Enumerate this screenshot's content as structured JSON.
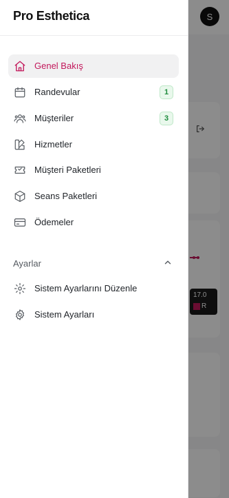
{
  "app": {
    "brand": "Pro Esthetica",
    "avatar_initial": "S"
  },
  "sidebar": {
    "items": [
      {
        "label": "Genel Bakış",
        "icon": "home-icon",
        "active": true
      },
      {
        "label": "Randevular",
        "icon": "calendar-icon",
        "badge": "1"
      },
      {
        "label": "Müşteriler",
        "icon": "users-icon",
        "badge": "3"
      },
      {
        "label": "Hizmetler",
        "icon": "services-icon"
      },
      {
        "label": "Müşteri Paketleri",
        "icon": "ticket-icon"
      },
      {
        "label": "Seans Paketleri",
        "icon": "package-icon"
      },
      {
        "label": "Ödemeler",
        "icon": "credit-card-icon"
      }
    ],
    "settings_section": {
      "title": "Ayarlar",
      "items": [
        {
          "label": "Sistem Ayarlarını Düzenle",
          "icon": "settings-edit-icon"
        },
        {
          "label": "Sistem Ayarları",
          "icon": "gear-icon"
        }
      ]
    }
  },
  "background": {
    "tooltip_date": "17.0",
    "tooltip_series_initial": "R"
  },
  "colors": {
    "accent": "#c2185b",
    "badge_green": "#1e8b3c"
  }
}
